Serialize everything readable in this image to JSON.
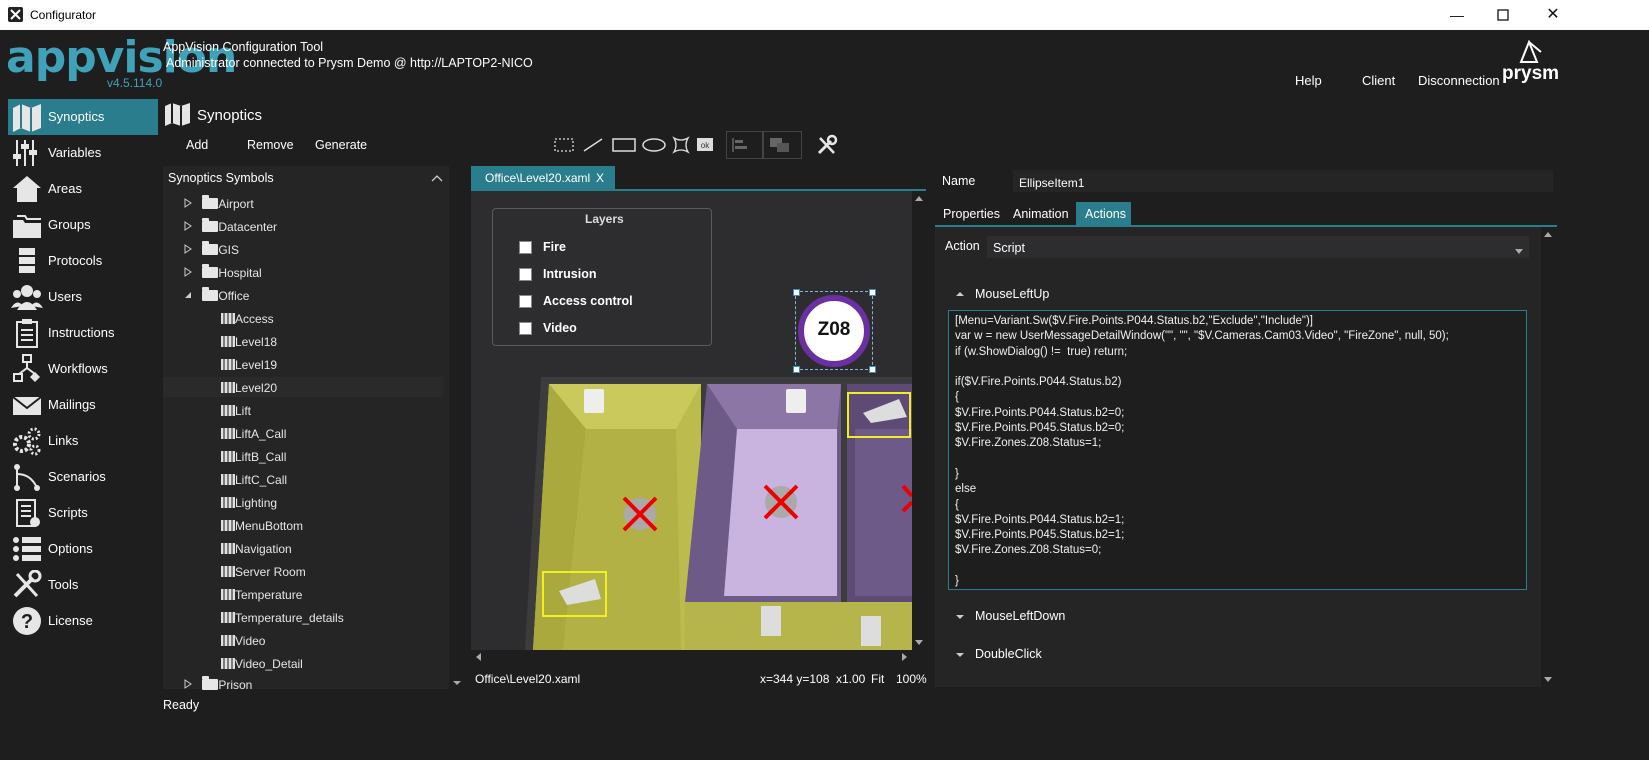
{
  "window": {
    "title": "Configurator"
  },
  "header": {
    "logo_text": "appvision",
    "version": "v4.5.114.0",
    "tool_name": "AppVision Configuration Tool",
    "connection": "Administrator connected to Prysm Demo @ http://LAPTOP2-NICO",
    "links": [
      "Help",
      "Client",
      "Disconnection"
    ],
    "brand": "prysm"
  },
  "nav": [
    {
      "label": "Synoptics",
      "icon": "map-icon",
      "active": true
    },
    {
      "label": "Variables",
      "icon": "sliders-icon"
    },
    {
      "label": "Areas",
      "icon": "home-icon"
    },
    {
      "label": "Groups",
      "icon": "folders-icon"
    },
    {
      "label": "Protocols",
      "icon": "server-icon"
    },
    {
      "label": "Users",
      "icon": "users-icon"
    },
    {
      "label": "Instructions",
      "icon": "clipboard-icon"
    },
    {
      "label": "Workflows",
      "icon": "workflow-icon"
    },
    {
      "label": "Mailings",
      "icon": "mail-icon"
    },
    {
      "label": "Links",
      "icon": "gears-icon"
    },
    {
      "label": "Scenarios",
      "icon": "branch-icon"
    },
    {
      "label": "Scripts",
      "icon": "script-icon"
    },
    {
      "label": "Options",
      "icon": "list-icon"
    },
    {
      "label": "Tools",
      "icon": "tools-icon"
    },
    {
      "label": "License",
      "icon": "help-icon"
    }
  ],
  "section": {
    "title": "Synoptics"
  },
  "toolbar": {
    "add": "Add",
    "remove": "Remove",
    "generate": "Generate"
  },
  "symbols_header": "Synoptics Symbols",
  "tree": {
    "folders_top": [
      "Airport",
      "Datacenter",
      "GIS",
      "Hospital"
    ],
    "office": "Office",
    "office_children": [
      "Access",
      "Level18",
      "Level19",
      "Level20",
      "Lift",
      "LiftA_Call",
      "LiftB_Call",
      "LiftC_Call",
      "Lighting",
      "MenuBottom",
      "Navigation",
      "Server Room",
      "Temperature",
      "Temperature_details",
      "Video",
      "Video_Detail"
    ],
    "selected": "Level20",
    "folders_bottom": [
      "Prison"
    ]
  },
  "editor": {
    "tab_label": "Office\\Level20.xaml",
    "tab_close": "X",
    "layers_title": "Layers",
    "layers": [
      "Fire",
      "Intrusion",
      "Access control",
      "Video"
    ],
    "zone_label": "Z08",
    "status_file": "Office\\Level20.xaml",
    "coords": "x=344 y=108",
    "zoom_factor": "x1.00",
    "fit": "Fit",
    "zoom_pct": "100%"
  },
  "props": {
    "name_label": "Name",
    "name_value": "EllipseItem1",
    "tabs": [
      "Properties",
      "Animation",
      "Actions"
    ],
    "active_tab": "Actions",
    "action_label": "Action",
    "action_value": "Script",
    "events": [
      "MouseLeftUp",
      "MouseLeftDown",
      "DoubleClick"
    ],
    "script": [
      "[Menu=Variant.Sw($V.Fire.Points.P044.Status.b2,\"Exclude\",\"Include\")]",
      "var w = new UserMessageDetailWindow(\"\", \"\", \"$V.Cameras.Cam03.Video\", \"FireZone\", null, 50);",
      "if (w.ShowDialog() !=  true) return;",
      "",
      "if($V.Fire.Points.P044.Status.b2)",
      "{",
      "$V.Fire.Points.P044.Status.b2=0;",
      "$V.Fire.Points.P045.Status.b2=0;",
      "$V.Fire.Zones.Z08.Status=1;",
      "",
      "}",
      "else",
      "{",
      "$V.Fire.Points.P044.Status.b2=1;",
      "$V.Fire.Points.P045.Status.b2=1;",
      "$V.Fire.Zones.Z08.Status=0;",
      "",
      "}"
    ]
  },
  "status": {
    "text": "Ready"
  },
  "colors": {
    "accent": "#2a7d8c",
    "logo": "#3fa2b8",
    "zone_ring": "#6a2fa0",
    "floor_yellow": "#b8b84a",
    "room_purple": "#7e6a96"
  }
}
